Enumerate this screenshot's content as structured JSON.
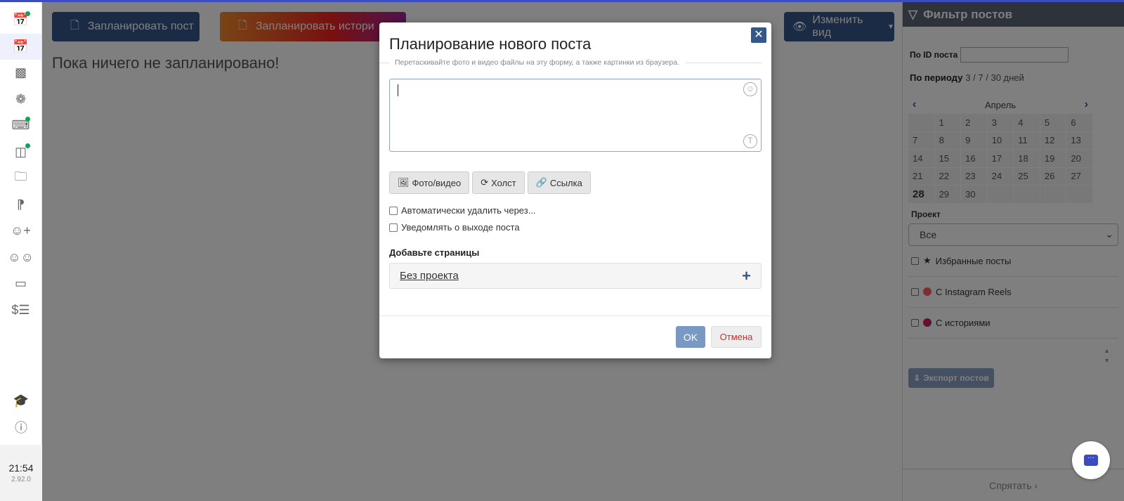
{
  "sidebar": {
    "items": [
      {
        "icon": "calendar-clock-icon",
        "dot": true
      },
      {
        "icon": "calendar-clock-icon",
        "active": true
      },
      {
        "icon": "bar-chart-icon"
      },
      {
        "icon": "ai-icon"
      },
      {
        "icon": "plug-icon",
        "dot": true
      },
      {
        "icon": "layout-icon",
        "dot": true
      },
      {
        "icon": "folder-icon"
      },
      {
        "icon": "rss-icon"
      },
      {
        "icon": "user-plus-icon"
      },
      {
        "icon": "users-icon"
      },
      {
        "icon": "credit-card-icon"
      },
      {
        "icon": "billing-icon"
      }
    ],
    "bottom": {
      "time": "21:54",
      "version": "2.92.0"
    }
  },
  "main": {
    "schedule_post": "Запланировать пост",
    "schedule_story": "Запланировать истори",
    "change_view": "Изменить вид",
    "empty": "Пока ничего не запланировано!"
  },
  "filter": {
    "title": "Фильтр постов",
    "by_id": "По ID поста",
    "by_period": "По периоду",
    "periods": "3 / 7 / 30 дней",
    "month": "Апрель",
    "days": [
      "",
      "1",
      "2",
      "3",
      "4",
      "5",
      "6",
      "7",
      "8",
      "9",
      "10",
      "11",
      "12",
      "13",
      "14",
      "15",
      "16",
      "17",
      "18",
      "19",
      "20",
      "21",
      "22",
      "23",
      "24",
      "25",
      "26",
      "27",
      "28",
      "29",
      "30",
      "",
      "",
      "",
      ""
    ],
    "today": "28",
    "project_label": "Проект",
    "project_value": "Все",
    "favorites": "Избранные посты",
    "reels": "С Instagram Reels",
    "stories": "С историями",
    "export": "Экспорт постов",
    "hide": "Спрятать"
  },
  "modal": {
    "title": "Планирование нового поста",
    "hint": "Перетаскивайте фото и видео файлы на эту форму, а также картинки из браузера.",
    "text_value": "",
    "photo": "Фото/видео",
    "canvas": "Холст",
    "link": "Ссылка",
    "auto_delete": "Автоматически удалить через...",
    "notify": "Уведомлять о выходе поста",
    "add_pages": "Добавьте страницы",
    "no_project": "Без проекта",
    "ok": "OK",
    "cancel": "Отмена"
  },
  "colors": {
    "accent": "#36578a",
    "brand": "#3b4cc0",
    "online": "#1a9e5c"
  }
}
